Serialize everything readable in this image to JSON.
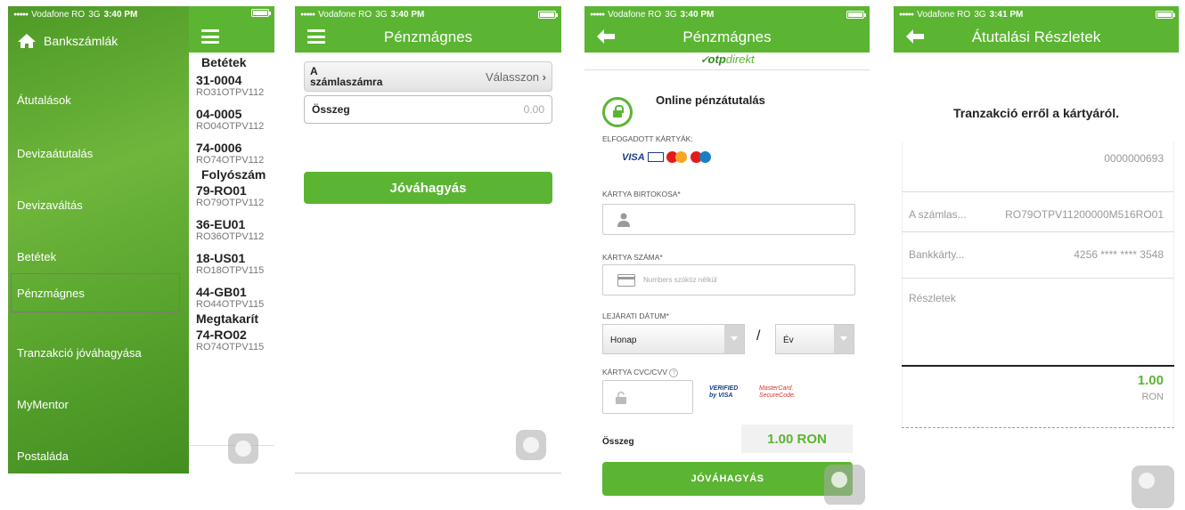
{
  "status": {
    "carrier": "Vodafone RO",
    "network": "3G",
    "signal": "●●●●●",
    "time_s1": "3:40 PM",
    "time_s2": "3:40 PM",
    "time_s3": "3:40 PM",
    "time_s4": "3:41 PM"
  },
  "screen1": {
    "menu_title": "Bankszámlák",
    "menu_items": [
      "Átutalások",
      "Devizaátutalás",
      "Devizaváltás",
      "Betétek",
      "Pénzmágnes",
      "Tranzakció jóváhagyása",
      "MyMentor",
      "Postaláda"
    ],
    "section_betetek": "Betétek",
    "section_folyoszamla": "Folyószám",
    "section_megtakaritas": "Megtakarít",
    "accounts": [
      {
        "num": "31-0004",
        "iban": "RO31OTPV112"
      },
      {
        "num": "04-0005",
        "iban": "RO04OTPV112"
      },
      {
        "num": "74-0006",
        "iban": "RO74OTPV112"
      },
      {
        "num": "79-RO01",
        "iban": "RO79OTPV112"
      },
      {
        "num": "36-EU01",
        "iban": "RO36OTPV112"
      },
      {
        "num": "18-US01",
        "iban": "RO18OTPV115"
      },
      {
        "num": "44-GB01",
        "iban": "RO44OTPV115"
      },
      {
        "num": "74-RO02",
        "iban": "RO74OTPV115"
      }
    ]
  },
  "screen2": {
    "title": "Pénzmágnes",
    "account_label": "A számlaszámra",
    "account_value": "Válasszon",
    "amount_label": "Összeg",
    "amount_value": "0.00",
    "approve_button": "Jóváhagyás"
  },
  "screen3": {
    "title": "Pénzmágnes",
    "brand_otp": "otp",
    "brand_direkt": "direkt",
    "heading": "Online pénzátutalás",
    "accepted_cards": "ELFOGADOTT KÁRTYÁK:",
    "visa": "VISA",
    "holder_label": "KÁRTYA BIRTOKOSA*",
    "number_label": "KÁRTYA SZÁMA*",
    "number_placeholder": "Numbers szóköz nélkül",
    "expiry_label": "LEJÁRATI DÁTUM*",
    "month_value": "Honap",
    "slash": "/",
    "year_value": "Év",
    "cvc_label": "KÁRTYA CVC/CVV",
    "verified_by_visa": "VERIFIED by VISA",
    "mastercard_securecode": "MasterCard. SecureCode.",
    "amount_label": "Összeg",
    "amount_value": "1.00 RON",
    "approve_button": "JÓVÁHAGYÁS"
  },
  "screen4": {
    "title": "Átutalási Részletek",
    "heading": "Tranzakció erről a kártyáról.",
    "ref": "0000000693",
    "account_label": "A számlas...",
    "account_value": "RO79OTPV11200000M516RO01",
    "card_label": "Bankkárty...",
    "card_value": "4256 **** **** 3548",
    "details_label": "Részletek",
    "total_amount": "1.00",
    "currency": "RON"
  },
  "colors": {
    "brand_green": "#5bb532",
    "dark_green": "#2e8a1e",
    "highlight_border": "#9b5fa5"
  }
}
